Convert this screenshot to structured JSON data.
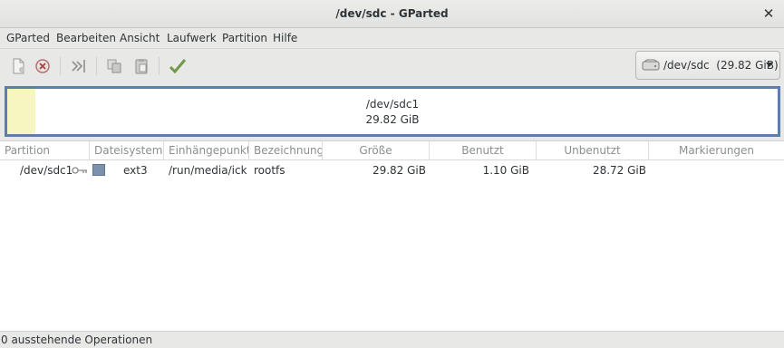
{
  "window": {
    "title": "/dev/sdc - GParted"
  },
  "menu": [
    "GParted",
    "Bearbeiten",
    "Ansicht",
    "Laufwerk",
    "Partition",
    "Hilfe"
  ],
  "toolbar": {
    "icons": [
      "new-partition-icon",
      "delete-icon",
      "resize-move-icon",
      "copy-icon",
      "paste-icon",
      "apply-icon"
    ]
  },
  "device_selector": {
    "label": "/dev/sdc  (29.82 GiB)",
    "icon": "harddisk-icon"
  },
  "disk_visual": {
    "partition": "/dev/sdc1",
    "size": "29.82 GiB",
    "used_fraction": 0.037,
    "colors": {
      "border": "#5b7fa6",
      "used": "#f8f6c0",
      "free": "#ffffff"
    }
  },
  "table": {
    "headers": [
      "Partition",
      "Dateisystem",
      "Einhängepunkt",
      "Bezeichnung",
      "Größe",
      "Benutzt",
      "Unbenutzt",
      "Markierungen"
    ],
    "rows": [
      {
        "partition": "/dev/sdc1",
        "filesystem": "ext3",
        "filesystem_color": "#7b91ad",
        "mountpoint": "/run/media/ick…",
        "label": "rootfs",
        "size": "29.82 GiB",
        "used": "1.10 GiB",
        "unused": "28.72 GiB",
        "flags": ""
      }
    ]
  },
  "status": {
    "text": "0 ausstehende Operationen"
  }
}
